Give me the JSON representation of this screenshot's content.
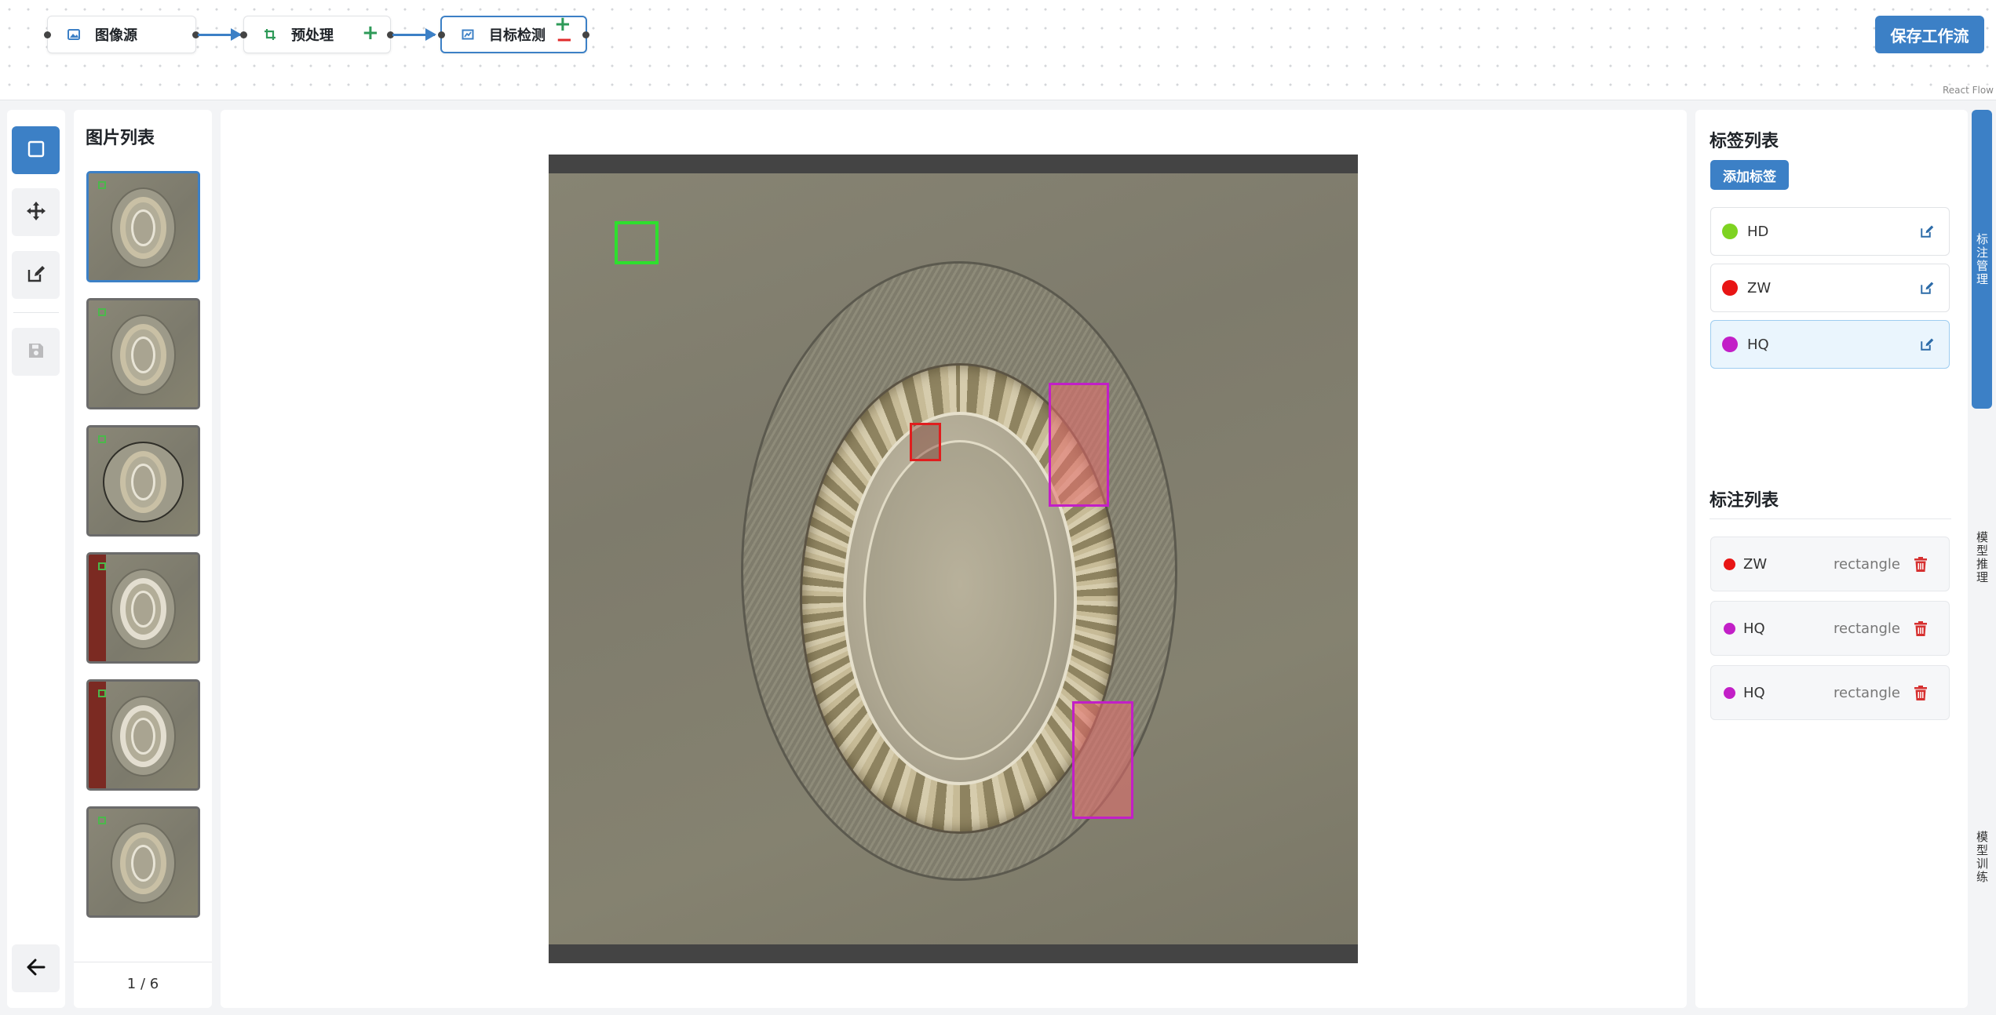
{
  "workflow": {
    "nodes": [
      {
        "label": "图像源",
        "icon": "image-icon"
      },
      {
        "label": "预处理",
        "icon": "crop-icon"
      },
      {
        "label": "目标检测",
        "icon": "detect-icon"
      }
    ],
    "save_label": "保存工作流",
    "attribution": "React Flow"
  },
  "tools": [
    {
      "name": "rectangle-tool",
      "icon": "square-icon",
      "active": true
    },
    {
      "name": "move-tool",
      "icon": "move-icon",
      "active": false
    },
    {
      "name": "edit-tool",
      "icon": "edit-icon",
      "active": false
    },
    {
      "name": "save-tool",
      "icon": "floppy-icon",
      "active": false,
      "disabled": true
    }
  ],
  "back_icon": "arrow-left-icon",
  "image_list": {
    "title": "图片列表",
    "count": 6,
    "selected_index": 0,
    "pager": "1 / 6"
  },
  "labels_panel": {
    "title": "标签列表",
    "add_label": "添加标签",
    "labels": [
      {
        "name": "HD",
        "color": "#7ed321",
        "selected": false
      },
      {
        "name": "ZW",
        "color": "#e81515",
        "selected": false
      },
      {
        "name": "HQ",
        "color": "#c21fc7",
        "selected": true
      }
    ]
  },
  "annotations_panel": {
    "title": "标注列表",
    "annotations": [
      {
        "label": "ZW",
        "color": "#e81515",
        "type": "rectangle"
      },
      {
        "label": "HQ",
        "color": "#c21fc7",
        "type": "rectangle"
      },
      {
        "label": "HQ",
        "color": "#c21fc7",
        "type": "rectangle"
      }
    ]
  },
  "side_tabs": [
    {
      "label": "标注管理",
      "active": true
    },
    {
      "label": "模型推理",
      "active": false
    },
    {
      "label": "模型训练",
      "active": false
    }
  ],
  "colors": {
    "accent": "#3c80c6",
    "hq": "#c21fc7",
    "zw": "#e81515",
    "hd": "#7ed321"
  }
}
